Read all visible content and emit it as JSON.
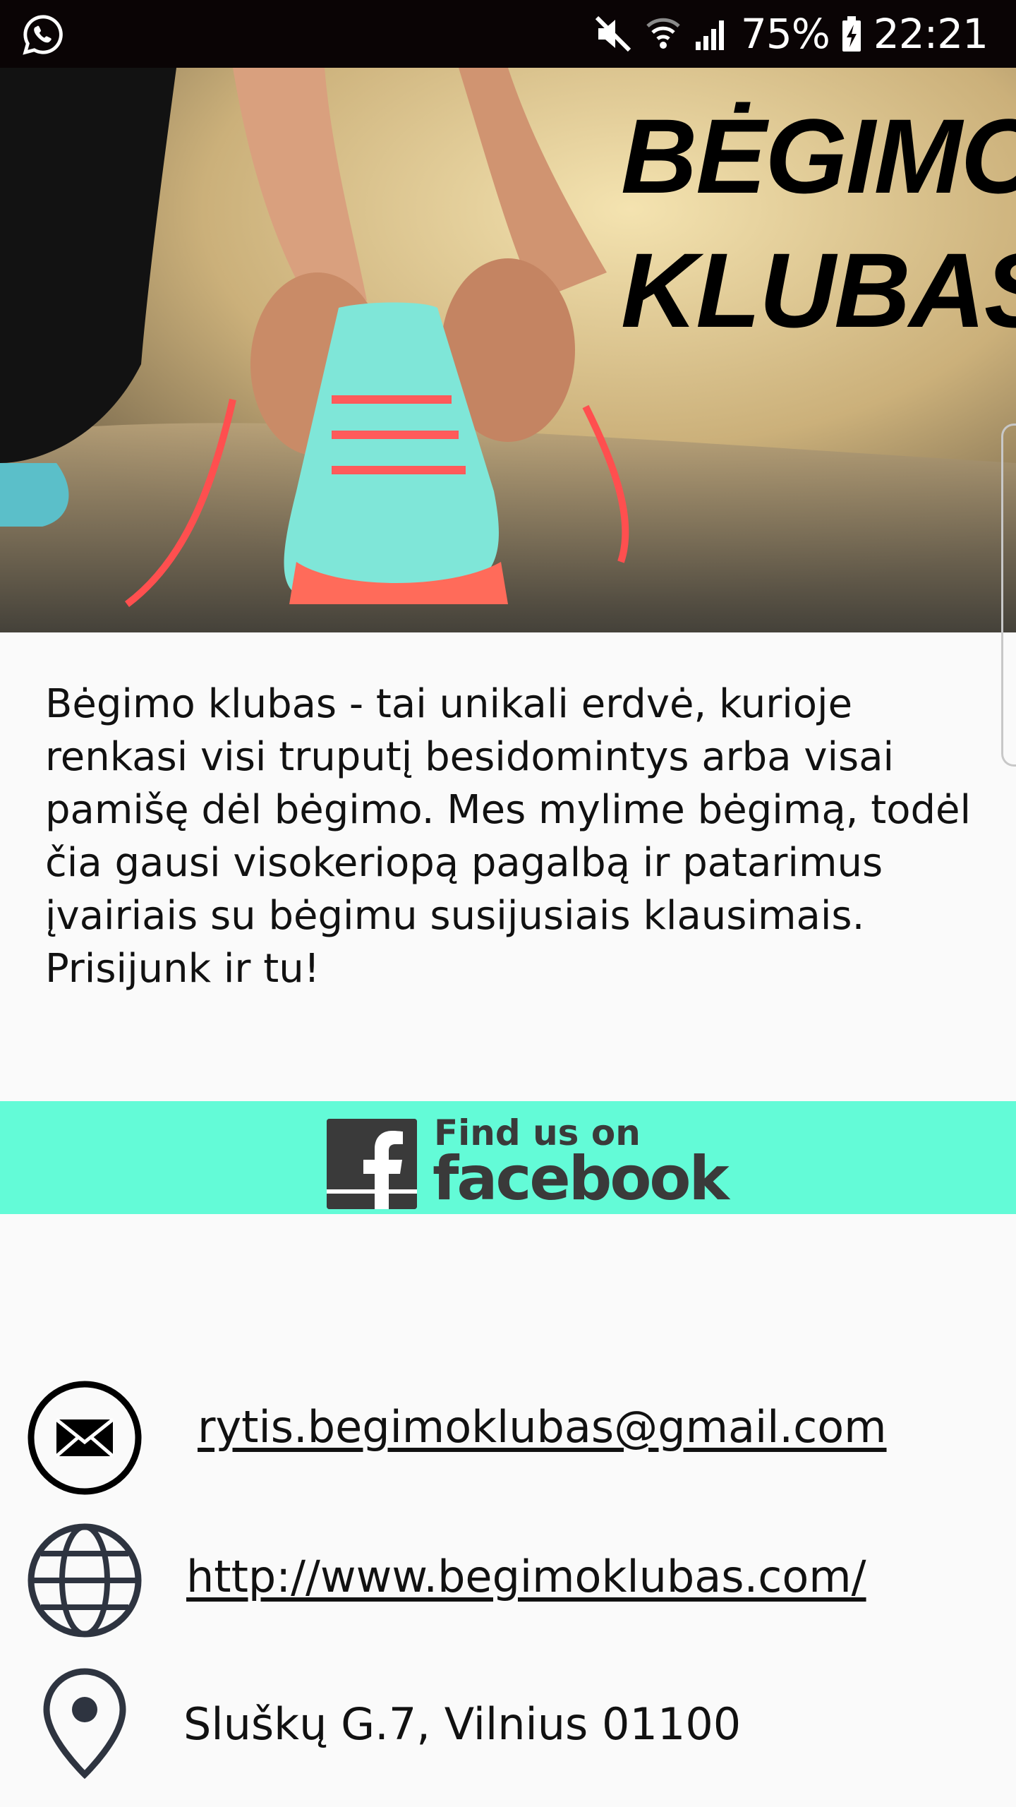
{
  "status_bar": {
    "battery_percent": "75%",
    "time": "22:21",
    "icons": [
      "whatsapp-icon",
      "mute-icon",
      "wifi-icon",
      "signal-icon",
      "battery-charging-icon"
    ]
  },
  "hero": {
    "title_line1": "BĖGIMO",
    "title_line2": "KLUBAS",
    "image": "person-tying-running-shoe"
  },
  "description": "Bėgimo klubas - tai unikali erdvė, kurioje renkasi visi truputį besidomintys arba visai pamišę dėl bėgimo. Mes mylime bėgimą, todėl čia gausi visokeriopą pagalbą ir patarimus įvairiais su bėgimu susijusiais klausimais.  Prisijunk ir tu!",
  "facebook": {
    "find_us": "Find us on",
    "brand": "facebook",
    "banner_color": "#63fbd7"
  },
  "contacts": {
    "email": "rytis.begimoklubas@gmail.com",
    "website": "http://www.begimoklubas.com/",
    "address": "Sluškų G.7, Vilnius 01100"
  },
  "colors": {
    "status_bar": "#0a0405",
    "background": "#fafafa",
    "text": "#111111",
    "icon_dark": "#2e3440"
  }
}
